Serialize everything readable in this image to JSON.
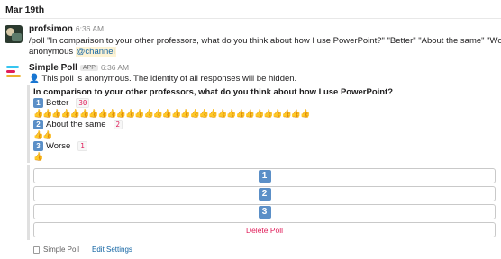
{
  "date_header": "Mar 19th",
  "message1": {
    "sender": "profsimon",
    "time": "6:36 AM",
    "line1": "/poll \"In comparison to your other professors, what do you think about how I use PowerPoint?\" \"Better\" \"About the same\" \"Worse\"",
    "line2_prefix": "anonymous ",
    "mention": "@channel"
  },
  "message2": {
    "sender": "Simple Poll",
    "badge": "APP",
    "time": "6:36 AM",
    "notice_icon": "person-silhouette-icon",
    "notice": "This poll is anonymous. The identity of all responses will be hidden.",
    "question": "In comparison to your other professors, what do you think about how I use PowerPoint?",
    "options": [
      {
        "keycap": "1",
        "label": "Better",
        "count": "30",
        "thumbs": "👍👍👍👍👍👍👍👍👍👍👍👍👍👍👍👍👍👍👍👍👍👍👍👍👍👍👍👍👍👍"
      },
      {
        "keycap": "2",
        "label": "About the same",
        "count": "2",
        "thumbs": "👍👍"
      },
      {
        "keycap": "3",
        "label": "Worse",
        "count": "1",
        "thumbs": "👍"
      }
    ],
    "vote_buttons": [
      "1",
      "2",
      "3"
    ],
    "delete_label": "Delete Poll",
    "footer_app": "Simple Poll",
    "footer_link": "Edit Settings"
  },
  "colors": {
    "keycap": "#5b8fc7",
    "delete": "#e01e5a",
    "link": "#1264a3",
    "logo_bars": [
      "#36c5f0",
      "#e01e5a",
      "#ecb22e"
    ]
  }
}
